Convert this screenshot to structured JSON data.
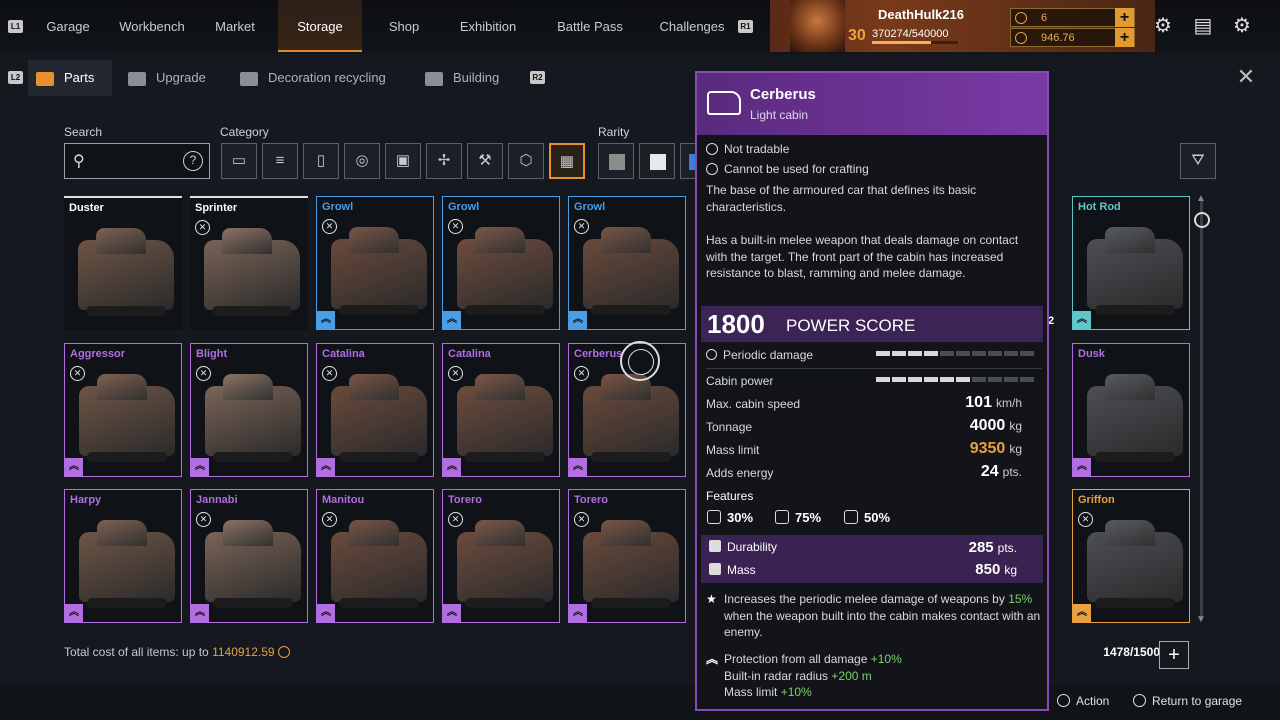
{
  "nav": {
    "left_key": "L1",
    "right_key": "R1",
    "tabs": [
      "Garage",
      "Workbench",
      "Market",
      "Storage",
      "Shop",
      "Exhibition",
      "Battle Pass",
      "Challenges"
    ],
    "active": "Storage"
  },
  "profile": {
    "name": "DeathHulk216",
    "level": "30",
    "xp": "370274/540000",
    "xp_fraction": 0.685,
    "currency1": "6",
    "currency2": "946.76"
  },
  "subtabs": {
    "left_key": "L2",
    "right_key": "R2",
    "items": [
      "Parts",
      "Upgrade",
      "Decoration recycling",
      "Building"
    ],
    "active": "Parts"
  },
  "filters": {
    "search_label": "Search",
    "search_help": "?",
    "category_label": "Category",
    "rarity_label": "Rarity",
    "category_icons": [
      "cabin-icon",
      "weapon-icon",
      "module-icon",
      "wheel-icon",
      "frame-icon",
      "drone-icon",
      "brush-icon",
      "gear-icon",
      "all-icon"
    ],
    "rarity_colors": [
      "#8c8c8c",
      "#e8e8e8",
      "#3b7fd8"
    ]
  },
  "items": [
    {
      "name": "Duster",
      "rarity": "common",
      "color": "#e0e0e0",
      "icon": false
    },
    {
      "name": "Sprinter",
      "rarity": "common",
      "color": "#e0e0e0",
      "icon": true
    },
    {
      "name": "Growl",
      "rarity": "rare",
      "color": "#4a9ee8",
      "icon": true
    },
    {
      "name": "Growl",
      "rarity": "rare",
      "color": "#4a9ee8",
      "icon": true
    },
    {
      "name": "Growl",
      "rarity": "rare",
      "color": "#4a9ee8",
      "icon": true
    },
    {
      "name": "Hot Rod",
      "rarity": "special",
      "color": "#5ec8c8",
      "icon": false
    },
    {
      "name": "Aggressor",
      "rarity": "epic",
      "color": "#b06ee0",
      "icon": true
    },
    {
      "name": "Blight",
      "rarity": "epic",
      "color": "#b06ee0",
      "icon": true
    },
    {
      "name": "Catalina",
      "rarity": "epic",
      "color": "#b06ee0",
      "icon": true
    },
    {
      "name": "Catalina",
      "rarity": "epic",
      "color": "#b06ee0",
      "icon": true
    },
    {
      "name": "Cerberus",
      "rarity": "epic",
      "color": "#b06ee0",
      "icon": true
    },
    {
      "name": "Dusk",
      "rarity": "epic",
      "color": "#b06ee0",
      "icon": false
    },
    {
      "name": "Harpy",
      "rarity": "epic",
      "color": "#b06ee0",
      "icon": false
    },
    {
      "name": "Jannabi",
      "rarity": "epic",
      "color": "#b06ee0",
      "icon": true
    },
    {
      "name": "Manitou",
      "rarity": "epic",
      "color": "#b06ee0",
      "icon": true
    },
    {
      "name": "Torero",
      "rarity": "epic",
      "color": "#b06ee0",
      "icon": true
    },
    {
      "name": "Torero",
      "rarity": "epic",
      "color": "#b06ee0",
      "icon": true
    },
    {
      "name": "Griffon",
      "rarity": "legendary",
      "color": "#e8a040",
      "icon": true
    }
  ],
  "hidden_count_fragment": "2",
  "total": {
    "label": "Total cost of all items: up to",
    "value": "1140912.59"
  },
  "capacity": "1478/1500",
  "footer": {
    "action": "Action",
    "return": "Return to garage"
  },
  "tooltip": {
    "title": "Cerberus",
    "subtitle": "Light cabin",
    "flags": [
      "Not tradable",
      "Cannot be used for crafting"
    ],
    "description1": "The base of the armoured car that defines its basic characteristics.",
    "description2": "Has a built-in melee weapon that deals damage on contact with the target. The front part of the cabin has increased resistance to blast, ramming and melee damage.",
    "power_score": "1800",
    "power_label": "POWER SCORE",
    "bars": [
      {
        "label": "Periodic damage",
        "fraction": 0.35
      },
      {
        "label": "Cabin power",
        "fraction": 0.55
      }
    ],
    "stats": [
      {
        "label": "Max. cabin speed",
        "value": "101",
        "unit": "km/h",
        "highlight": false
      },
      {
        "label": "Tonnage",
        "value": "4000",
        "unit": "kg",
        "highlight": false
      },
      {
        "label": "Mass limit",
        "value": "9350",
        "unit": "kg",
        "highlight": true
      },
      {
        "label": "Adds energy",
        "value": "24",
        "unit": "pts.",
        "highlight": false
      }
    ],
    "features_label": "Features",
    "features": [
      "30%",
      "75%",
      "50%"
    ],
    "durability_label": "Durability",
    "durability": "285",
    "durability_unit": "pts.",
    "mass_label": "Mass",
    "mass": "850",
    "mass_unit": "kg",
    "perk_pre": "Increases the periodic melee damage of weapons by",
    "perk_value": "15%",
    "perk_post": "when the weapon built into the cabin makes contact with an enemy.",
    "bonus1_label": "Protection from all damage",
    "bonus1_value": "+10%",
    "bonus2_label": "Built-in radar radius",
    "bonus2_value": "+200 m",
    "bonus3_label": "Mass limit",
    "bonus3_value": "+10%",
    "highlight_color": "#e8a040",
    "bonus_color": "#7ad36a"
  }
}
